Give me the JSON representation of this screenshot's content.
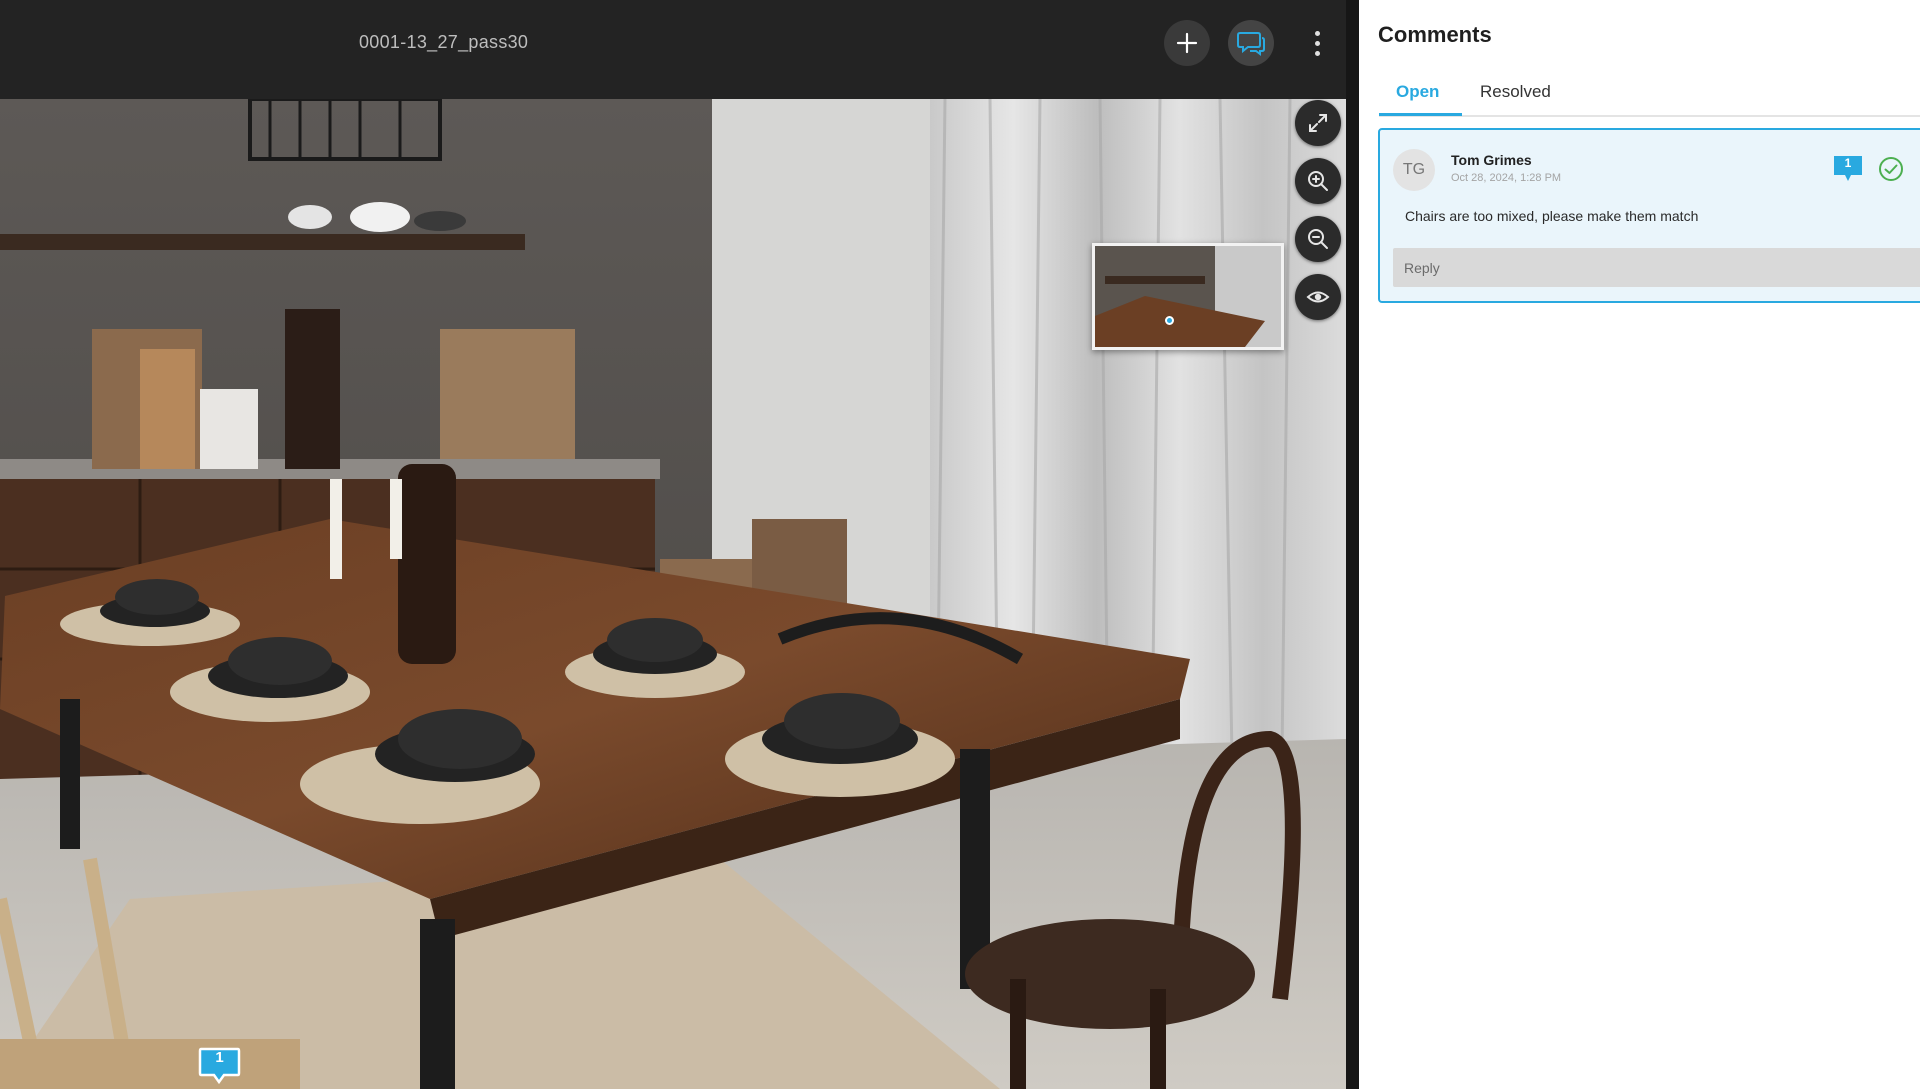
{
  "viewer": {
    "file_name": "0001-13_27_pass30",
    "buttons": {
      "add_icon": "plus-icon",
      "comments_icon": "chat-bubbles-icon",
      "menu_icon": "vertical-ellipsis-icon"
    },
    "tools": [
      "fullscreen-icon",
      "zoom-in-icon",
      "zoom-out-icon",
      "eye-icon"
    ],
    "pins": [
      {
        "label": "1"
      }
    ]
  },
  "comments": {
    "title": "Comments",
    "tabs": [
      {
        "label": "Open",
        "active": true
      },
      {
        "label": "Resolved",
        "active": false
      }
    ],
    "items": [
      {
        "initials": "TG",
        "author": "Tom Grimes",
        "timestamp": "Oct 28, 2024, 1:28 PM",
        "badge": "1",
        "text": "Chairs are too mixed, please make them match",
        "reply_placeholder": "Reply"
      }
    ]
  },
  "colors": {
    "accent": "#29a9e0",
    "resolve": "#4caf50",
    "toolbar_bg": "#232323",
    "card_bg": "#eaf5fb"
  }
}
